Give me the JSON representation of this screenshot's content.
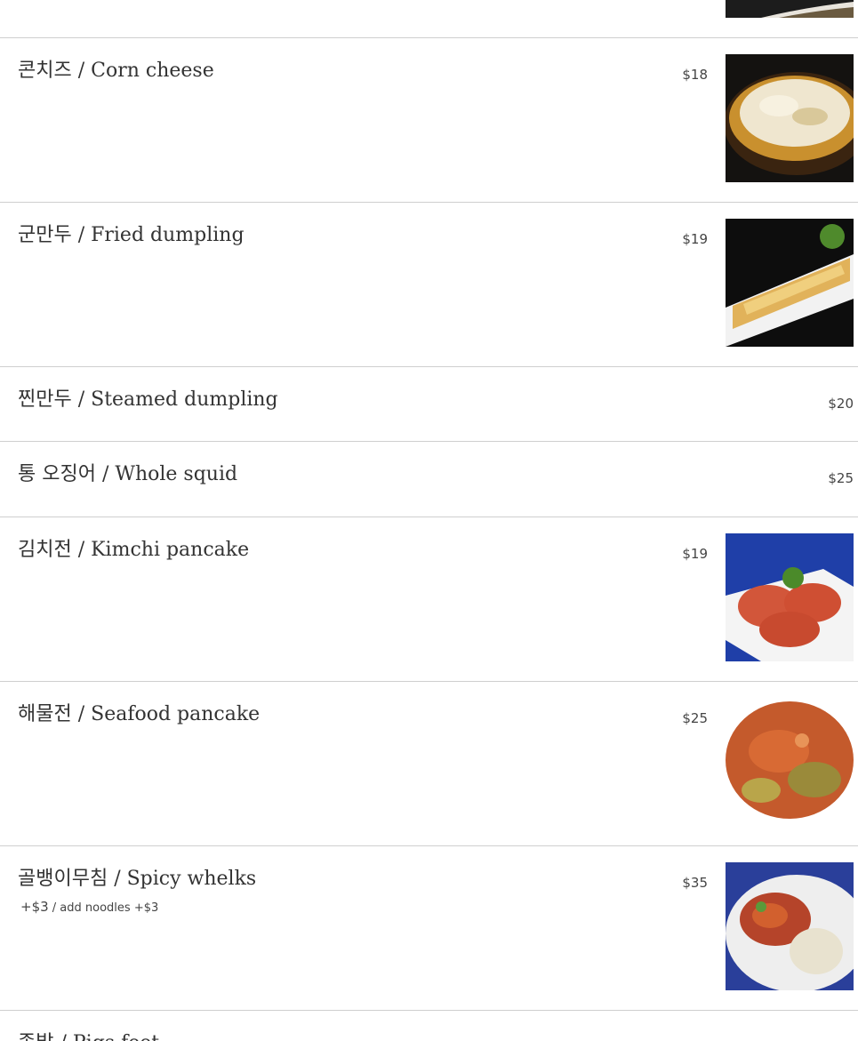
{
  "menu": {
    "items": [
      {
        "name": "콘치즈 / Corn cheese",
        "price": "$18",
        "image": "corn-cheese-photo"
      },
      {
        "name": "군만두 / Fried dumpling",
        "price": "$19",
        "image": "fried-dumpling-photo"
      },
      {
        "name": "찐만두 / Steamed dumpling",
        "price": "$20"
      },
      {
        "name": "통 오징어 / Whole squid",
        "price": "$25"
      },
      {
        "name": "김치전 / Kimchi pancake",
        "price": "$19",
        "image": "kimchi-pancake-photo"
      },
      {
        "name": "해물전 / Seafood pancake",
        "price": "$25",
        "image": "seafood-pancake-photo"
      },
      {
        "name": "골뱅이무침 / Spicy whelks",
        "price": "$35",
        "image": "spicy-whelks-photo",
        "note_price": "+$3",
        "note_text": " / add noodles +$3"
      },
      {
        "name": "족발 / Pigs feet",
        "price": ""
      }
    ]
  }
}
